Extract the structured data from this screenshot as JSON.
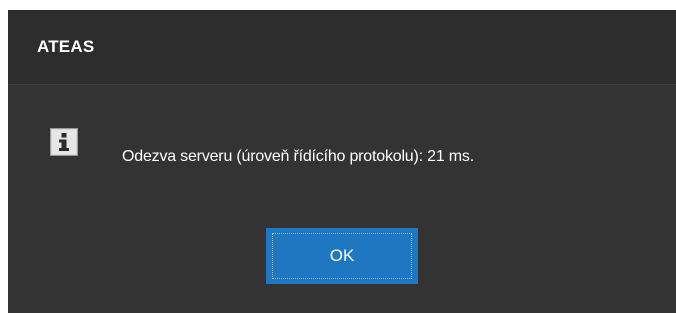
{
  "dialog": {
    "title": "ATEAS",
    "icon": "info-icon",
    "message": "Odezva serveru (úroveň řídícího protokolu): 21 ms.",
    "ok_label": "OK"
  },
  "colors": {
    "background": "#333333",
    "title_bar": "#2d2d2d",
    "button": "#1e77c0",
    "text": "#ffffff"
  }
}
